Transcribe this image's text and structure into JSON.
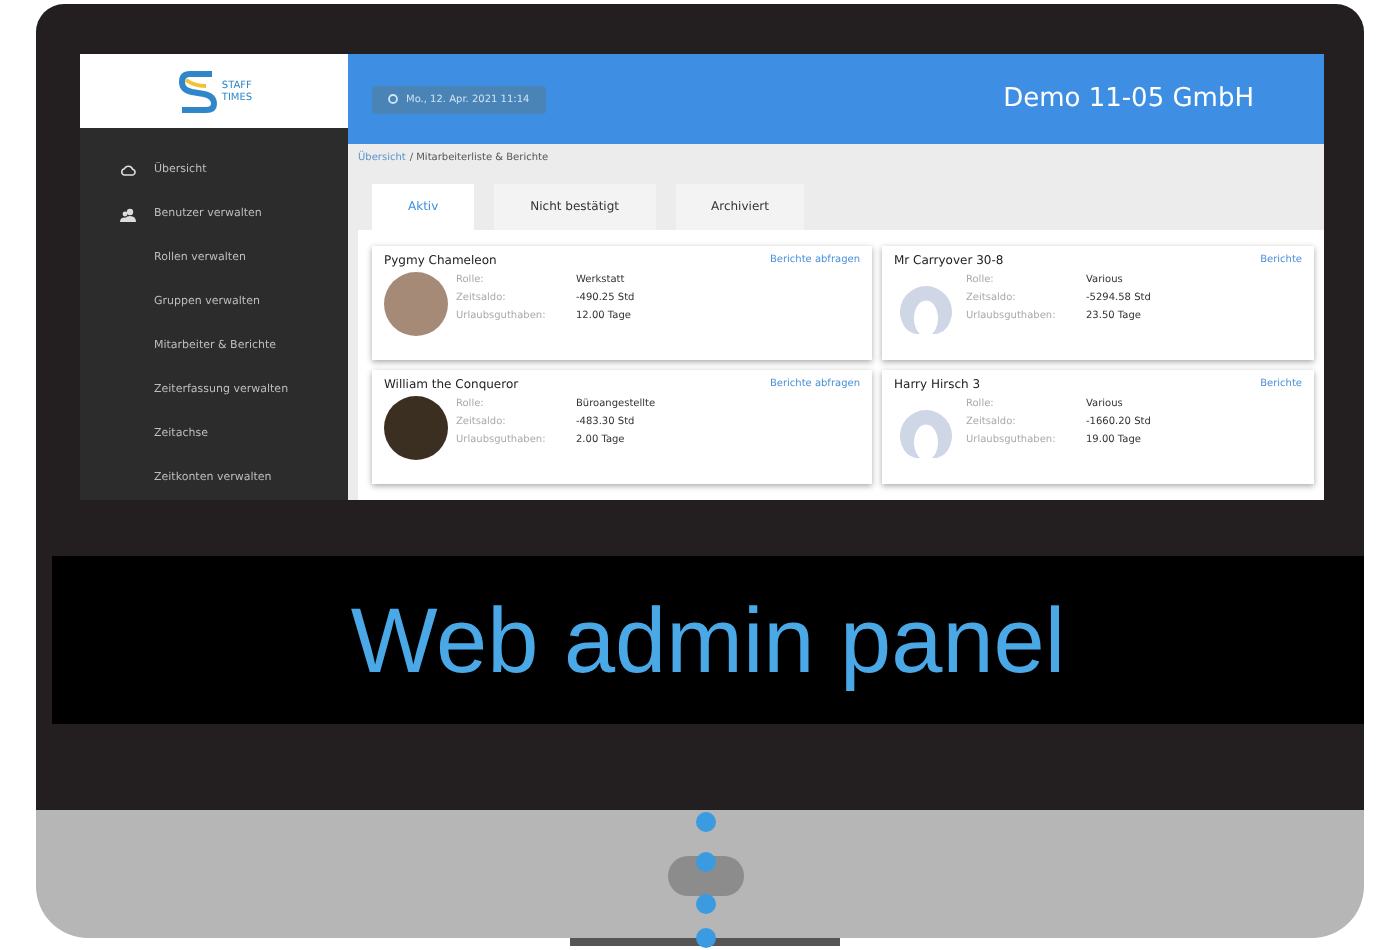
{
  "caption": "Web admin panel",
  "logo": {
    "lines": [
      "STAFF",
      "TIMES"
    ]
  },
  "header": {
    "date": "Mo., 12. Apr. 2021 11:14",
    "company": "Demo 11-05 GmbH"
  },
  "sidebar": {
    "items": [
      {
        "label": "Übersicht",
        "kind": "cloud"
      },
      {
        "label": "Benutzer verwalten",
        "kind": "users"
      },
      {
        "label": "Rollen verwalten",
        "kind": "plain"
      },
      {
        "label": "Gruppen verwalten",
        "kind": "plain"
      },
      {
        "label": "Mitarbeiter & Berichte",
        "kind": "plain"
      },
      {
        "label": "Zeiterfassung verwalten",
        "kind": "plain"
      },
      {
        "label": "Zeitachse",
        "kind": "plain"
      },
      {
        "label": "Zeitkonten verwalten",
        "kind": "plain"
      }
    ]
  },
  "breadcrumb": {
    "link": "Übersicht",
    "current": "/ Mitarbeiterliste & Berichte"
  },
  "tabs": [
    {
      "label": "Aktiv",
      "selected": true
    },
    {
      "label": "Nicht bestätigt",
      "selected": false
    },
    {
      "label": "Archiviert",
      "selected": false
    }
  ],
  "cards": [
    {
      "name": "Pygmy Chameleon",
      "link": "Berichte abfragen",
      "kind": "photo",
      "fields": [
        {
          "label": "Rolle:",
          "value": "Werkstatt"
        },
        {
          "label": "Zeitsaldo:",
          "value": "-490.25 Std"
        },
        {
          "label": "Urlaubsguthaben:",
          "value": "12.00 Tage"
        }
      ]
    },
    {
      "name": "Mr Carryover 30-8",
      "link": "Berichte",
      "kind": "silhouette",
      "fields": [
        {
          "label": "Rolle:",
          "value": "Various"
        },
        {
          "label": "Zeitsaldo:",
          "value": "-5294.58 Std"
        },
        {
          "label": "Urlaubsguthaben:",
          "value": "23.50 Tage"
        }
      ]
    },
    {
      "name": "William the Conqueror",
      "link": "Berichte abfragen",
      "kind": "portrait",
      "fields": [
        {
          "label": "Rolle:",
          "value": "Büroangestellte"
        },
        {
          "label": "Zeitsaldo:",
          "value": "-483.30 Std"
        },
        {
          "label": "Urlaubsguthaben:",
          "value": "2.00 Tage"
        }
      ]
    },
    {
      "name": "Harry Hirsch 3",
      "link": "Berichte",
      "kind": "silhouette",
      "fields": [
        {
          "label": "Rolle:",
          "value": "Various"
        },
        {
          "label": "Zeitsaldo:",
          "value": "-1660.20 Std"
        },
        {
          "label": "Urlaubsguthaben:",
          "value": "19.00 Tage"
        }
      ]
    }
  ]
}
